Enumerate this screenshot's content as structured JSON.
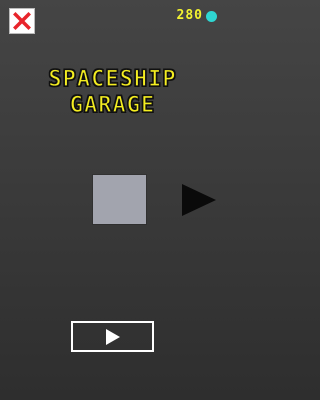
{
  "header": {
    "close_icon": "close-x-icon",
    "coins": {
      "count": "280",
      "icon": "coin-icon",
      "color": "#2fd6d2"
    }
  },
  "title": {
    "line1": "SPACESHIP",
    "line2": "GARAGE",
    "color": "#f5ee21"
  },
  "garage": {
    "ship_color": "#a2a4ae",
    "next_icon": "right-triangle-icon"
  },
  "play": {
    "icon": "play-icon"
  },
  "colors": {
    "background": "#3c3c3c",
    "close_red": "#e8242b"
  }
}
